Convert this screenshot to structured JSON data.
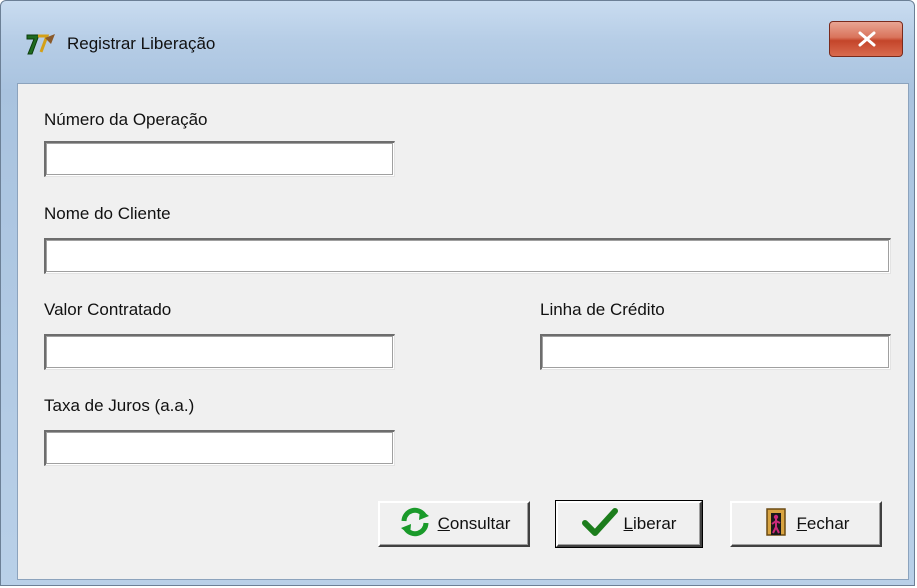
{
  "window": {
    "title": "Registrar Liberação",
    "app_icon": "app-logo-icon",
    "close_icon": "close-icon"
  },
  "form": {
    "numero_operacao": {
      "label": "Número da Operação",
      "value": ""
    },
    "nome_cliente": {
      "label": "Nome do Cliente",
      "value": ""
    },
    "valor_contratado": {
      "label": "Valor Contratado",
      "value": ""
    },
    "linha_credito": {
      "label": "Linha de Crédito",
      "value": ""
    },
    "taxa_juros": {
      "label": "Taxa de Juros (a.a.)",
      "value": ""
    }
  },
  "buttons": {
    "consultar": {
      "mnemonic": "C",
      "rest": "onsultar",
      "icon": "refresh-icon"
    },
    "liberar": {
      "mnemonic": "L",
      "rest": "iberar",
      "icon": "checkmark-icon"
    },
    "fechar": {
      "mnemonic": "F",
      "rest": "echar",
      "icon": "exit-door-icon"
    }
  },
  "colors": {
    "close_button": "#c4452a",
    "check_green": "#1c7d1c",
    "refresh_green": "#1a9a2a"
  }
}
